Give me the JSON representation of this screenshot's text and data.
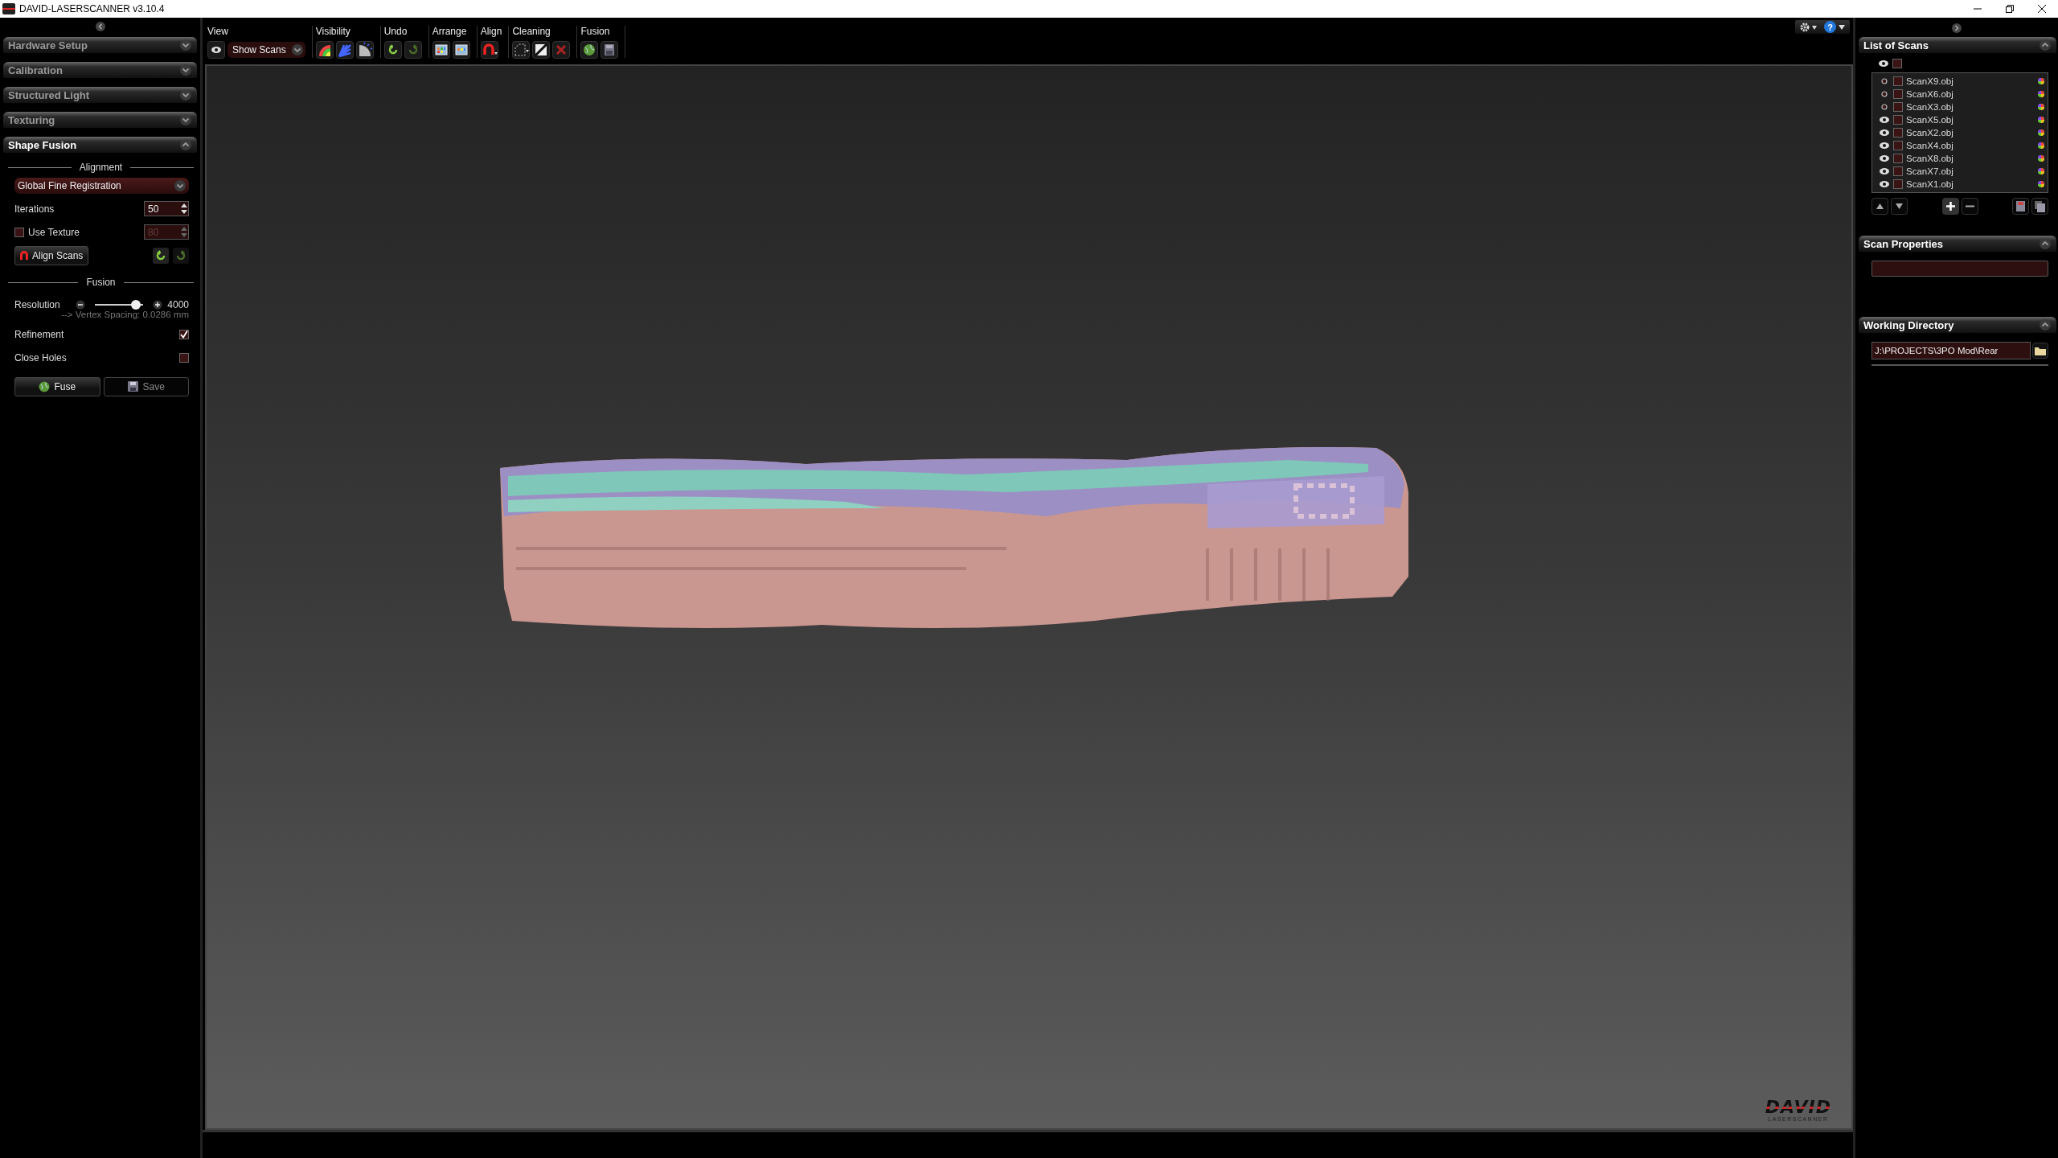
{
  "window": {
    "title": "DAVID-LASERSCANNER v3.10.4"
  },
  "left_panel": {
    "sections": [
      {
        "title": "Hardware Setup",
        "expanded": false
      },
      {
        "title": "Calibration",
        "expanded": false
      },
      {
        "title": "Structured Light",
        "expanded": false
      },
      {
        "title": "Texturing",
        "expanded": false
      },
      {
        "title": "Shape Fusion",
        "expanded": true
      }
    ],
    "alignment": {
      "heading": "Alignment",
      "method": "Global Fine Registration",
      "iterations": {
        "label": "Iterations",
        "value": "50"
      },
      "use_texture": {
        "label": "Use Texture",
        "checked": false,
        "value": "80"
      },
      "align_button": "Align Scans"
    },
    "fusion": {
      "heading": "Fusion",
      "resolution": {
        "label": "Resolution",
        "level": 0.85,
        "value": "4000"
      },
      "vertex_spacing": "--> Vertex Spacing: 0.0286 mm",
      "refinement": {
        "label": "Refinement",
        "checked": true
      },
      "close_holes": {
        "label": "Close Holes",
        "checked": false
      },
      "buttons": [
        {
          "label": "Fuse",
          "kind": "fuse",
          "disabled": false
        },
        {
          "label": "Save",
          "kind": "save",
          "disabled": true
        }
      ]
    }
  },
  "toolbar": {
    "groups": [
      {
        "label": "View"
      },
      {
        "label": "Visibility"
      },
      {
        "label": "Undo"
      },
      {
        "label": "Arrange"
      },
      {
        "label": "Align"
      },
      {
        "label": "Cleaning"
      },
      {
        "label": "Fusion"
      }
    ],
    "view_select": "Show Scans",
    "help": "?"
  },
  "scans": {
    "title": "List of Scans",
    "select_all_checked": false,
    "items": [
      {
        "name": "ScanX9.obj",
        "visible": false,
        "checked": false
      },
      {
        "name": "ScanX6.obj",
        "visible": false,
        "checked": false
      },
      {
        "name": "ScanX3.obj",
        "visible": false,
        "checked": false
      },
      {
        "name": "ScanX5.obj",
        "visible": true,
        "checked": false
      },
      {
        "name": "ScanX2.obj",
        "visible": true,
        "checked": false
      },
      {
        "name": "ScanX4.obj",
        "visible": true,
        "checked": false
      },
      {
        "name": "ScanX8.obj",
        "visible": true,
        "checked": false
      },
      {
        "name": "ScanX7.obj",
        "visible": true,
        "checked": false
      },
      {
        "name": "ScanX1.obj",
        "visible": true,
        "checked": false
      }
    ]
  },
  "scan_properties": {
    "title": "Scan Properties"
  },
  "working_directory": {
    "title": "Working Directory",
    "value": "J:\\PROJECTS\\3PO Mod\\Rear"
  },
  "logo": {
    "name": "DAVID",
    "subtitle": "LASERSCANNER"
  }
}
